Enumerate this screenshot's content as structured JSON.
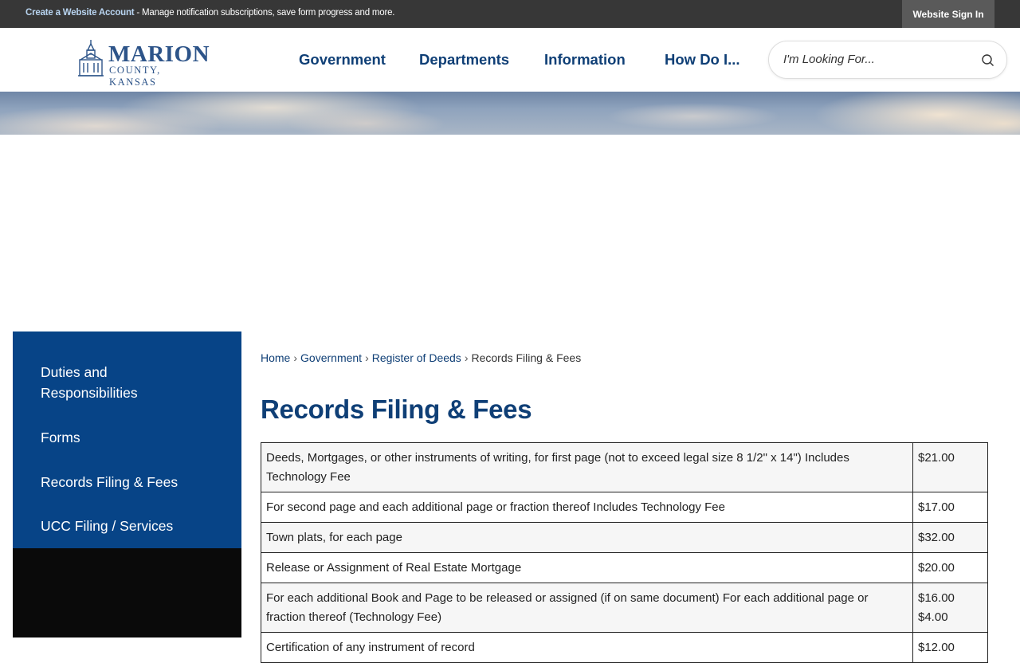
{
  "topbar": {
    "create_account_link": "Create a Website Account",
    "message": " - Manage notification subscriptions, save form progress and more.",
    "sign_in": "Website Sign In"
  },
  "logo": {
    "main": "MARION",
    "sub": "COUNTY, KANSAS"
  },
  "nav": [
    "Government",
    "Departments",
    "Information",
    "How Do I..."
  ],
  "search": {
    "placeholder": "I'm Looking For..."
  },
  "sidebar": {
    "items": [
      {
        "label": "Duties and Responsibilities"
      },
      {
        "label": "Forms"
      },
      {
        "label": "Records Filing & Fees"
      },
      {
        "label": "UCC Filing / Services"
      }
    ]
  },
  "breadcrumb": [
    "Home",
    "Government",
    "Register of Deeds",
    "Records Filing & Fees"
  ],
  "page_title": "Records Filing & Fees",
  "fees": [
    {
      "desc": "Deeds, Mortgages, or other instruments of writing, for first page (not to exceed legal size 8 1/2\" x 14\") Includes Technology Fee",
      "fee": "$21.00"
    },
    {
      "desc": "For second page and each additional page or fraction thereof Includes Technology Fee",
      "fee": "$17.00"
    },
    {
      "desc": "Town plats, for each page",
      "fee": "$32.00"
    },
    {
      "desc": "Release or Assignment of Real Estate Mortgage",
      "fee": "$20.00"
    },
    {
      "desc": "For each additional Book and Page to be released or assigned (if on same document) For each additional page or fraction thereof (Technology Fee)",
      "fee": "$16.00",
      "fee2": "$4.00"
    },
    {
      "desc": "Certification of any instrument of record",
      "fee": "$12.00"
    }
  ],
  "colors": {
    "nav_blue": "#0f3f76",
    "sidebar_blue": "#074487",
    "topbar": "#373737"
  }
}
